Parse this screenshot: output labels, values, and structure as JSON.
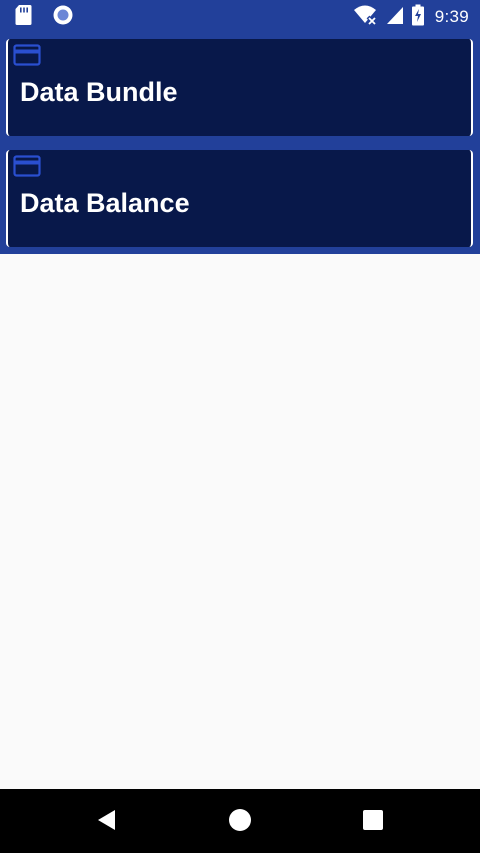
{
  "status_bar": {
    "time": "9:39",
    "background_color": "#22409a",
    "left_icons": [
      "sd-card-icon",
      "sync-circle-icon"
    ],
    "right_icons": [
      "wifi-icon",
      "cell-signal-icon",
      "battery-charging-icon"
    ]
  },
  "cards": [
    {
      "icon": "credit-card-icon",
      "title": "Data Bundle"
    },
    {
      "icon": "credit-card-icon",
      "title": "Data Balance"
    }
  ],
  "colors": {
    "band": "#22409a",
    "card": "#08184a",
    "card_icon": "#2a4fd0",
    "page_background": "#fafafa",
    "nav_bar": "#000000"
  },
  "nav_bar": {
    "buttons": [
      "back-icon",
      "home-icon",
      "recents-icon"
    ]
  }
}
